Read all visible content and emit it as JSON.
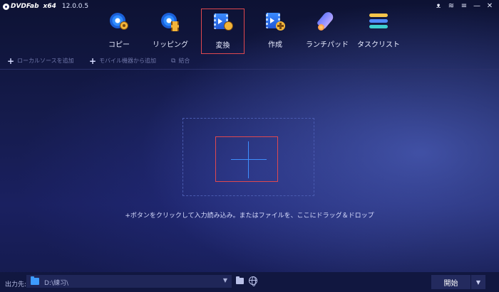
{
  "app": {
    "brand": "DVDFab",
    "arch": "x64",
    "version": "12.0.0.5"
  },
  "window_controls": [
    {
      "name": "menu-mascot-icon",
      "glyph": "☗"
    },
    {
      "name": "wifi-icon",
      "glyph": "≋"
    },
    {
      "name": "menu-icon",
      "glyph": "≡"
    },
    {
      "name": "minimize-icon",
      "glyph": "—"
    },
    {
      "name": "close-icon",
      "glyph": "✕"
    }
  ],
  "modules": [
    {
      "label": "コピー",
      "icon": "copy-disc-icon"
    },
    {
      "label": "リッピング",
      "icon": "ripper-disc-icon"
    },
    {
      "label": "変換",
      "icon": "converter-film-icon",
      "active": true
    },
    {
      "label": "作成",
      "icon": "creator-film-icon"
    },
    {
      "label": "ランチパッド",
      "icon": "launchpad-rocket-icon"
    },
    {
      "label": "タスクリスト",
      "icon": "task-list-icon"
    }
  ],
  "toolbar": {
    "add_local_source": "ローカルソースを追加",
    "add_mobile_device": "モバイル機器から追加",
    "merge": "結合"
  },
  "dropzone": {
    "hint": "+ボタンをクリックして入力読み込み。またはファイルを、ここにドラッグ＆ドロップ"
  },
  "bottom": {
    "output_label": "出力先:",
    "output_path": "D:\\練习\\",
    "start_button": "開始"
  },
  "colors": {
    "accent_red": "#e0484f",
    "accent_blue": "#3f8fff",
    "badge_gold": "#f2b43a",
    "task_bar_yellow": "#f5c54a",
    "task_bar_blue": "#4f8bff",
    "task_bar_teal": "#3ed0d0"
  }
}
